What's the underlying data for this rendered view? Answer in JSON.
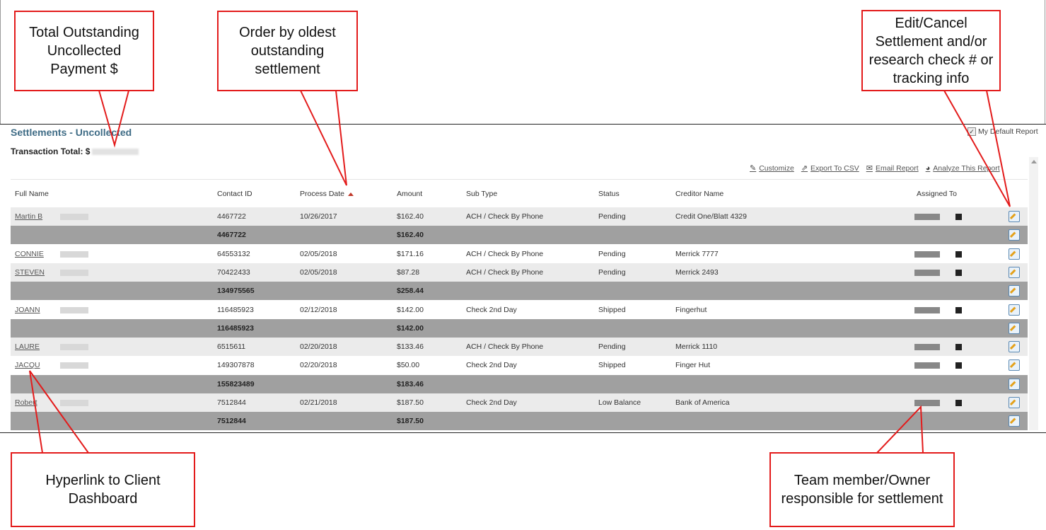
{
  "report": {
    "title": "Settlements - Uncollected",
    "default_report_label": "My Default Report",
    "transaction_total_label": "Transaction Total: $"
  },
  "actions": [
    {
      "label": "Customize",
      "icon": "customize-icon"
    },
    {
      "label": "Export To CSV",
      "icon": "export-icon"
    },
    {
      "label": "Email Report",
      "icon": "email-icon"
    },
    {
      "label": "Analyze This Report",
      "icon": "pie-chart-icon"
    }
  ],
  "columns": {
    "full_name": "Full Name",
    "contact_id": "Contact ID",
    "process_date": "Process Date",
    "amount": "Amount",
    "sub_type": "Sub Type",
    "status": "Status",
    "creditor_name": "Creditor Name",
    "assigned_to": "Assigned To"
  },
  "rows": [
    {
      "kind": "item",
      "name": "Martin B",
      "contact_id": "4467722",
      "date": "10/26/2017",
      "amount": "$162.40",
      "sub_type": "ACH / Check By Phone",
      "status": "Pending",
      "creditor": "Credit One/Blatt 4329"
    },
    {
      "kind": "subtotal",
      "contact_id": "4467722",
      "amount": "$162.40"
    },
    {
      "kind": "item",
      "name": "CONNIE",
      "contact_id": "64553132",
      "date": "02/05/2018",
      "amount": "$171.16",
      "sub_type": "ACH / Check By Phone",
      "status": "Pending",
      "creditor": "Merrick 7777"
    },
    {
      "kind": "item",
      "name": "STEVEN",
      "contact_id": "70422433",
      "date": "02/05/2018",
      "amount": "$87.28",
      "sub_type": "ACH / Check By Phone",
      "status": "Pending",
      "creditor": "Merrick 2493"
    },
    {
      "kind": "subtotal",
      "contact_id": "134975565",
      "amount": "$258.44"
    },
    {
      "kind": "item",
      "name": "JOANN",
      "contact_id": "116485923",
      "date": "02/12/2018",
      "amount": "$142.00",
      "sub_type": "Check 2nd Day",
      "status": "Shipped",
      "creditor": "Fingerhut"
    },
    {
      "kind": "subtotal",
      "contact_id": "116485923",
      "amount": "$142.00"
    },
    {
      "kind": "item",
      "name": "LAURE",
      "contact_id": "6515611",
      "date": "02/20/2018",
      "amount": "$133.46",
      "sub_type": "ACH / Check By Phone",
      "status": "Pending",
      "creditor": "Merrick 1110"
    },
    {
      "kind": "item",
      "name": "JACQU",
      "contact_id": "149307878",
      "date": "02/20/2018",
      "amount": "$50.00",
      "sub_type": "Check 2nd Day",
      "status": "Shipped",
      "creditor": "Finger Hut"
    },
    {
      "kind": "subtotal",
      "contact_id": "155823489",
      "amount": "$183.46"
    },
    {
      "kind": "item",
      "name": "Robert",
      "contact_id": "7512844",
      "date": "02/21/2018",
      "amount": "$187.50",
      "sub_type": "Check 2nd Day",
      "status": "Low Balance",
      "creditor": "Bank of America"
    },
    {
      "kind": "subtotal",
      "contact_id": "7512844",
      "amount": "$187.50"
    }
  ],
  "callouts": {
    "total_outstanding": "Total Outstanding Uncollected Payment $",
    "order_by": "Order by oldest outstanding settlement",
    "edit_cancel": "Edit/Cancel Settlement and/or research check # or tracking info",
    "hyperlink": "Hyperlink to Client Dashboard",
    "team_member": "Team member/Owner responsible for settlement"
  },
  "colors": {
    "title": "#3f6c86",
    "callout_border": "#e31b1b",
    "subtotal_row": "#a0a0a0",
    "alt_row": "#ebebeb"
  }
}
